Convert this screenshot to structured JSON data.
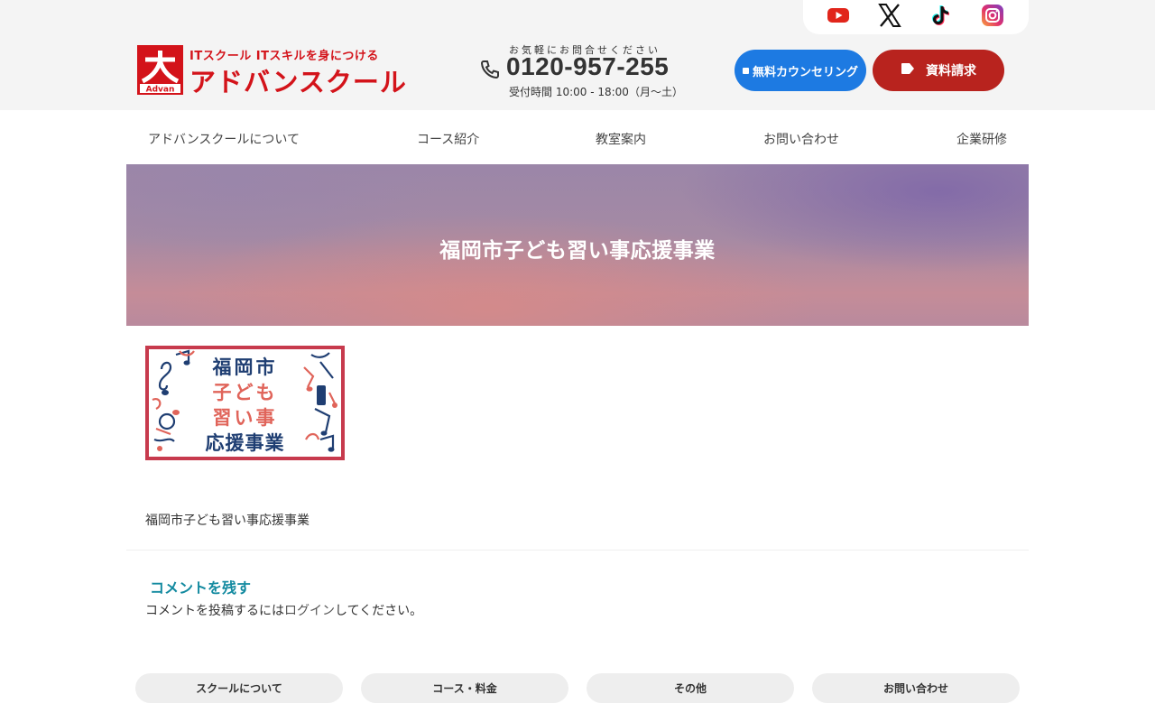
{
  "header": {
    "logo": {
      "tagline": "ITスクール ITスキルを身につける",
      "name": "アドバンスクール",
      "mark_text": "Advan"
    },
    "sns": [
      {
        "name": "youtube-icon",
        "color": "#e1251b"
      },
      {
        "name": "x-icon",
        "color": "#111111"
      },
      {
        "name": "tiktok-icon",
        "color": "#111111"
      },
      {
        "name": "instagram-icon",
        "color": "#c13584"
      }
    ],
    "phone": {
      "caption": "お気軽にお問合せください",
      "number": "0120-957-255",
      "hours": "受付時間 10:00 - 18:00（月〜土）"
    },
    "buttons": {
      "counsel": "無料カウンセリング",
      "documents": "資料請求"
    }
  },
  "nav": [
    "アドバンスクールについて",
    "コース紹介",
    "教室案内",
    "お問い合わせ",
    "企業研修"
  ],
  "hero": {
    "title": "福岡市子ども習い事応援事業"
  },
  "banner": {
    "lines": [
      "福岡市",
      "子ども",
      "習い事",
      "応援事業"
    ]
  },
  "content": {
    "caption": "福岡市子ども習い事応援事業"
  },
  "comments": {
    "title": "コメントを残す",
    "text_before": "コメントを投稿するには",
    "login_link": "ログイン",
    "text_after": "してください。"
  },
  "footer_tabs": [
    "スクールについて",
    "コース・料金",
    "その他",
    "お問い合わせ"
  ],
  "colors": {
    "brand_red": "#d3131a",
    "counsel_blue": "#1d7ae2",
    "docs_red": "#b8231e",
    "comment_teal": "#138aa0"
  }
}
